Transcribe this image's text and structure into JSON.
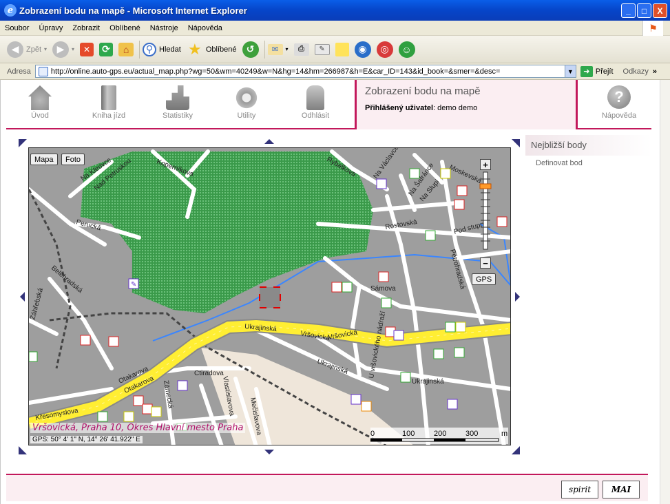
{
  "window": {
    "title": "Zobrazení bodu na mapě - Microsoft Internet Explorer",
    "buttons": [
      "_",
      "□",
      "X"
    ]
  },
  "menu": [
    "Soubor",
    "Úpravy",
    "Zobrazit",
    "Oblíbené",
    "Nástroje",
    "Nápověda"
  ],
  "toolbar": {
    "back": "Zpět",
    "search": "Hledat",
    "favorites": "Oblíbené"
  },
  "address": {
    "label": "Adresa",
    "url": "http://online.auto-gps.eu/actual_map.php?wg=50&wm=40249&w=N&hg=14&hm=266987&h=E&car_ID=143&id_book=&smer=&desc=",
    "go": "Přejít",
    "links": "Odkazy"
  },
  "nav": [
    {
      "label": "Úvod",
      "icon": "home-icon"
    },
    {
      "label": "Kniha jízd",
      "icon": "book-icon"
    },
    {
      "label": "Statistiky",
      "icon": "stats-icon"
    },
    {
      "label": "Utility",
      "icon": "gear-icon"
    },
    {
      "label": "Odhlásit",
      "icon": "lock-icon"
    }
  ],
  "header": {
    "page_title": "Zobrazení bodu na mapě",
    "user_label": "Přihlášený uživatel",
    "user_name": "demo demo",
    "help": "Nápověda"
  },
  "sidebar": {
    "heading": "Nejbližší body",
    "link": "Definovat bod"
  },
  "map": {
    "btn_map": "Mapa",
    "btn_photo": "Foto",
    "zoom_in": "+",
    "zoom_out": "−",
    "gps": "GPS",
    "address": "Vršovická, Praha 10, Okres Hlavní mesto Praha",
    "gps_coords": "GPS: 50° 4' 1\" N, 14° 26' 41.922\" E",
    "scale_labels": [
      "0",
      "100",
      "200",
      "300",
      "m"
    ],
    "streets": [
      "Koperníkova",
      "Na Kleovce",
      "Nad Petruskou",
      "Perucká",
      "Rybalkova",
      "Na Václavce",
      "Na Šafránce",
      "Moskevská",
      "Na Slupi",
      "Rostovská",
      "Pod stupni",
      "Petrohradská",
      "Sámova",
      "Vršovická",
      "Ukrajinská",
      "U vršovického nádraží",
      "Belehradská",
      "Záhřebská",
      "Otakarova",
      "Ctiradova",
      "Vlastislavova",
      "Zámecká",
      "Křesomyslova",
      "Mečislavova"
    ]
  },
  "footer": {
    "badge1": "spirit",
    "badge2": "MAI"
  }
}
